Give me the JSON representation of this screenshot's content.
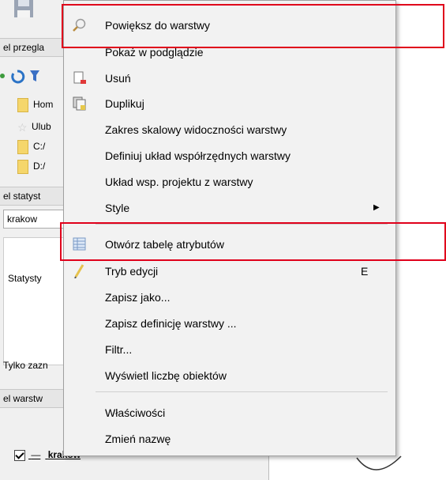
{
  "background": {
    "panels": {
      "browser_title": "el przegla",
      "stats_title": "el statyst",
      "layers_title": "el warstw"
    },
    "browser_items": [
      "Hom",
      "Ulub",
      "C:/",
      "D:/"
    ],
    "layer_combo": "krakow",
    "stats_label": "Statysty",
    "only_selected": "Tylko zazn",
    "layer_name": "krakow"
  },
  "menu": {
    "items": [
      {
        "label": "Powiększ do warstwy",
        "icon": "zoom-to-layer-icon"
      },
      {
        "label": "Pokaż w podglądzie",
        "icon": ""
      },
      {
        "label": "Usuń",
        "icon": "remove-layer-icon"
      },
      {
        "label": "Duplikuj",
        "icon": "duplicate-layer-icon"
      },
      {
        "label": "Zakres skalowy widoczności warstwy",
        "icon": ""
      },
      {
        "label": "Definiuj układ współrzędnych warstwy",
        "icon": ""
      },
      {
        "label": "Układ wsp. projektu z warstwy",
        "icon": ""
      },
      {
        "label": "Style",
        "icon": "",
        "submenu": true
      },
      {
        "label": "Otwórz tabelę atrybutów",
        "icon": "attribute-table-icon"
      },
      {
        "label": "Tryb edycji",
        "icon": "pencil-icon",
        "shortcut": "E"
      },
      {
        "label": "Zapisz jako...",
        "icon": ""
      },
      {
        "label": "Zapisz definicję warstwy ...",
        "icon": ""
      },
      {
        "label": "Filtr...",
        "icon": ""
      },
      {
        "label": "Wyświetl liczbę obiektów",
        "icon": ""
      },
      {
        "label": "Właściwości",
        "icon": ""
      },
      {
        "label": "Zmień nazwę",
        "icon": ""
      }
    ]
  },
  "colors": {
    "highlight": "#e0001b",
    "menu_bg": "#f2f2f2"
  }
}
